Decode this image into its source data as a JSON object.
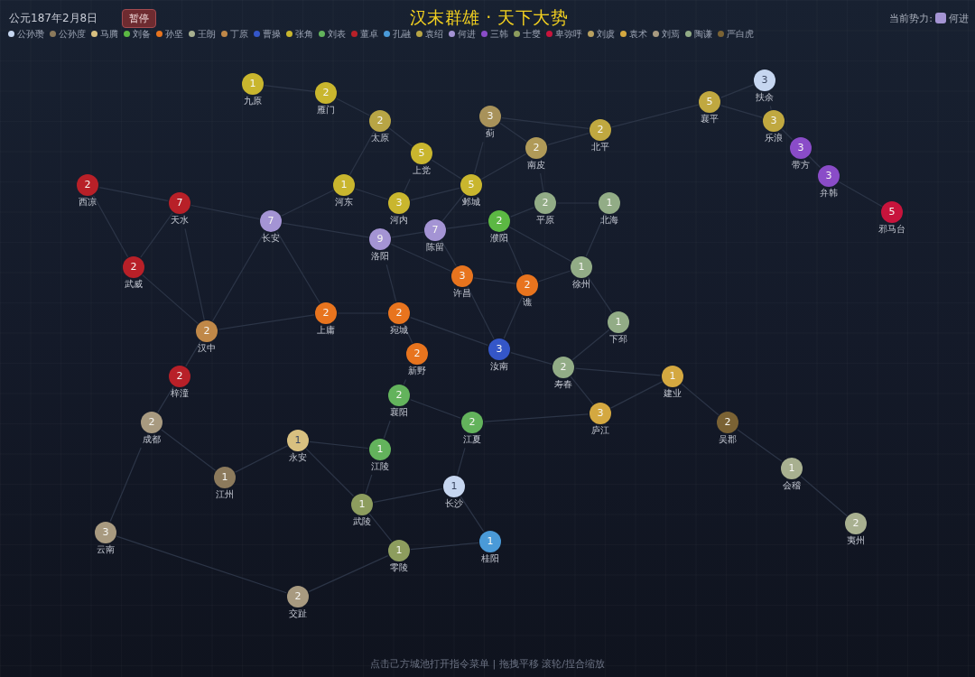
{
  "date": "公元187年2月8日",
  "pause_button": "暂停",
  "title": "汉末群雄 · 天下大势",
  "current_faction": {
    "label": "当前势力:",
    "name": "何进",
    "color": "#a494d4"
  },
  "legend": [
    {
      "name": "公孙瓒",
      "color": "#c6d6f0"
    },
    {
      "name": "公孙度",
      "color": "#8c7a5c"
    },
    {
      "name": "马腾",
      "color": "#d8c080"
    },
    {
      "name": "刘备",
      "color": "#5cb843"
    },
    {
      "name": "孙坚",
      "color": "#e8741e"
    },
    {
      "name": "王朗",
      "color": "#a8b090"
    },
    {
      "name": "丁原",
      "color": "#c08848"
    },
    {
      "name": "曹操",
      "color": "#3456c8"
    },
    {
      "name": "张角",
      "color": "#c9b62e"
    },
    {
      "name": "刘表",
      "color": "#63b35c"
    },
    {
      "name": "董卓",
      "color": "#b82028"
    },
    {
      "name": "孔融",
      "color": "#4a9ad8"
    },
    {
      "name": "袁绍",
      "color": "#b8a545"
    },
    {
      "name": "何进",
      "color": "#a494d4"
    },
    {
      "name": "三韩",
      "color": "#8a4cc8"
    },
    {
      "name": "士燮",
      "color": "#8d9d5e"
    },
    {
      "name": "卑弥呼",
      "color": "#c8143c"
    },
    {
      "name": "刘虞",
      "color": "#b8a060"
    },
    {
      "name": "袁术",
      "color": "#d4a840"
    },
    {
      "name": "刘焉",
      "color": "#a89a80"
    },
    {
      "name": "陶谦",
      "color": "#92ac86"
    },
    {
      "name": "严白虎",
      "color": "#7a6234"
    }
  ],
  "cities": [
    {
      "name": "扶余",
      "count": "3",
      "color": "#c6d6f0"
    },
    {
      "name": "九原",
      "count": "1",
      "color": "#c9b62e"
    },
    {
      "name": "雁门",
      "count": "2",
      "color": "#c9b62e"
    },
    {
      "name": "襄平",
      "count": "5",
      "color": "#c0a840"
    },
    {
      "name": "蓟",
      "count": "3",
      "color": "#a8925a"
    },
    {
      "name": "太原",
      "count": "2",
      "color": "#b8a545"
    },
    {
      "name": "乐浪",
      "count": "3",
      "color": "#c0a840"
    },
    {
      "name": "北平",
      "count": "2",
      "color": "#c0a840"
    },
    {
      "name": "南皮",
      "count": "2",
      "color": "#b09a58"
    },
    {
      "name": "带方",
      "count": "3",
      "color": "#8a4cc8"
    },
    {
      "name": "上党",
      "count": "5",
      "color": "#c9b62e"
    },
    {
      "name": "弁韩",
      "count": "3",
      "color": "#8a4cc8"
    },
    {
      "name": "西凉",
      "count": "2",
      "color": "#b82028"
    },
    {
      "name": "河东",
      "count": "1",
      "color": "#c9b62e"
    },
    {
      "name": "邺城",
      "count": "5",
      "color": "#c9b62e"
    },
    {
      "name": "天水",
      "count": "7",
      "color": "#b82028"
    },
    {
      "name": "河内",
      "count": "3",
      "color": "#c9b62e"
    },
    {
      "name": "平原",
      "count": "2",
      "color": "#92ac86"
    },
    {
      "name": "北海",
      "count": "1",
      "color": "#92ac86"
    },
    {
      "name": "邪马台",
      "count": "5",
      "color": "#c8143c"
    },
    {
      "name": "长安",
      "count": "7",
      "color": "#a494d4"
    },
    {
      "name": "濮阳",
      "count": "2",
      "color": "#5cb843"
    },
    {
      "name": "陈留",
      "count": "7",
      "color": "#a494d4"
    },
    {
      "name": "洛阳",
      "count": "9",
      "color": "#a494d4"
    },
    {
      "name": "武威",
      "count": "2",
      "color": "#b82028"
    },
    {
      "name": "徐州",
      "count": "1",
      "color": "#92ac86"
    },
    {
      "name": "许昌",
      "count": "3",
      "color": "#e8741e"
    },
    {
      "name": "谯",
      "count": "2",
      "color": "#e8741e"
    },
    {
      "name": "上庸",
      "count": "2",
      "color": "#e8741e"
    },
    {
      "name": "宛城",
      "count": "2",
      "color": "#e8741e"
    },
    {
      "name": "下邳",
      "count": "1",
      "color": "#92ac86"
    },
    {
      "name": "汉中",
      "count": "2",
      "color": "#c08848"
    },
    {
      "name": "汝南",
      "count": "3",
      "color": "#3456c8"
    },
    {
      "name": "新野",
      "count": "2",
      "color": "#e8741e"
    },
    {
      "name": "寿春",
      "count": "2",
      "color": "#92ac86"
    },
    {
      "name": "梓潼",
      "count": "2",
      "color": "#b82028"
    },
    {
      "name": "建业",
      "count": "1",
      "color": "#d4a840"
    },
    {
      "name": "襄阳",
      "count": "2",
      "color": "#63b35c"
    },
    {
      "name": "庐江",
      "count": "3",
      "color": "#d4a840"
    },
    {
      "name": "成都",
      "count": "2",
      "color": "#a89a80"
    },
    {
      "name": "江夏",
      "count": "2",
      "color": "#63b35c"
    },
    {
      "name": "吴郡",
      "count": "2",
      "color": "#7a6234"
    },
    {
      "name": "永安",
      "count": "1",
      "color": "#d8c080"
    },
    {
      "name": "江陵",
      "count": "1",
      "color": "#63b35c"
    },
    {
      "name": "会稽",
      "count": "1",
      "color": "#a8b090"
    },
    {
      "name": "江州",
      "count": "1",
      "color": "#8c7a5c"
    },
    {
      "name": "长沙",
      "count": "1",
      "color": "#c6d6f0"
    },
    {
      "name": "武陵",
      "count": "1",
      "color": "#8d9d5e"
    },
    {
      "name": "夷州",
      "count": "2",
      "color": "#a8b090"
    },
    {
      "name": "云南",
      "count": "3",
      "color": "#a89a80"
    },
    {
      "name": "桂阳",
      "count": "1",
      "color": "#4a9ad8"
    },
    {
      "name": "零陵",
      "count": "1",
      "color": "#8d9d5e"
    },
    {
      "name": "交趾",
      "count": "2",
      "color": "#a89a80"
    }
  ],
  "hint": "点击己方城池打开指令菜单 | 拖拽平移 滚轮/捏合缩放"
}
